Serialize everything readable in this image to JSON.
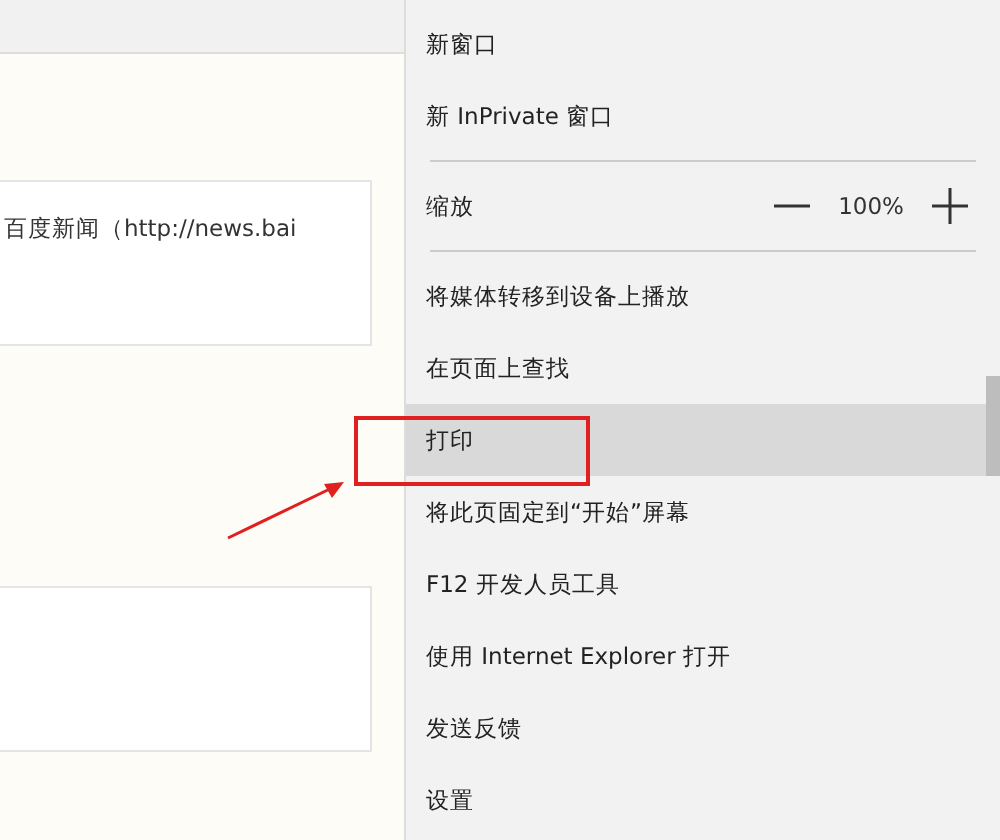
{
  "page": {
    "card": {
      "text": "百度新闻（http://news.bai"
    }
  },
  "menu": {
    "items": [
      {
        "kind": "item",
        "label": "新窗口",
        "selected": false
      },
      {
        "kind": "item",
        "label": "新 InPrivate 窗口",
        "selected": false
      },
      {
        "kind": "divider"
      },
      {
        "kind": "zoom",
        "label": "缩放",
        "value": "100%"
      },
      {
        "kind": "divider"
      },
      {
        "kind": "item",
        "label": "将媒体转移到设备上播放",
        "selected": false
      },
      {
        "kind": "item",
        "label": "在页面上查找",
        "selected": false
      },
      {
        "kind": "item",
        "label": "打印",
        "selected": true
      },
      {
        "kind": "item",
        "label": "将此页固定到“开始”屏幕",
        "selected": false
      },
      {
        "kind": "item",
        "label": "F12 开发人员工具",
        "selected": false
      },
      {
        "kind": "item",
        "label": "使用 Internet Explorer 打开",
        "selected": false
      },
      {
        "kind": "item",
        "label": "发送反馈",
        "selected": false
      },
      {
        "kind": "item",
        "label": "设置",
        "selected": false
      }
    ]
  }
}
